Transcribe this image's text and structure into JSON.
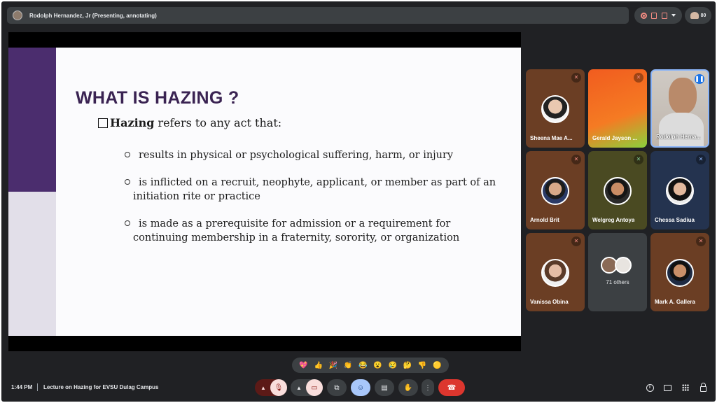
{
  "topbar": {
    "presenter_title": "Rodolph Hernandez, Jr (Presenting, annotating)",
    "participant_count": "80"
  },
  "slide": {
    "heading": "WHAT IS HAZING ?",
    "lead_term": "Hazing",
    "lead_rest": "refers to any act that:",
    "bullets": [
      {
        "line1": "results in physical or psychological suffering, harm, or injury",
        "line2": ""
      },
      {
        "line1": "is inflicted on a recruit, neophyte, applicant, or member as part of an",
        "line2": "initiation rite or practice"
      },
      {
        "line1": "is made as a prerequisite for admission or a requirement for",
        "line2": "continuing membership in a fraternity, sorority, or organization"
      }
    ]
  },
  "participants": [
    {
      "name": "Sheena Mae A...",
      "mic": "off"
    },
    {
      "name": "Gerald Jayson ...",
      "mic": "off"
    },
    {
      "name": "Rodolph Herna...",
      "mic": "speaking"
    },
    {
      "name": "Arnold Brit",
      "mic": "off"
    },
    {
      "name": "Welgreg Antoya",
      "mic": "off"
    },
    {
      "name": "Chessa Sadiua",
      "mic": "off"
    },
    {
      "name": "Vanissa Obina",
      "mic": "off"
    },
    {
      "name": "71 others",
      "mic": ""
    },
    {
      "name": "Mark A. Gallera",
      "mic": "off"
    }
  ],
  "reactions": [
    "💖",
    "👍",
    "🎉",
    "👏",
    "😂",
    "😮",
    "😢",
    "🤔",
    "👎",
    "🟡"
  ],
  "footer": {
    "time": "1:44 PM",
    "meeting_title": "Lecture on Hazing for EVSU Dulag Campus"
  },
  "colors": {
    "slide_band": "#4b2d6e",
    "slide_heading": "#3a2352",
    "end_call": "#dc362e",
    "active_border": "#8ab4f8"
  }
}
